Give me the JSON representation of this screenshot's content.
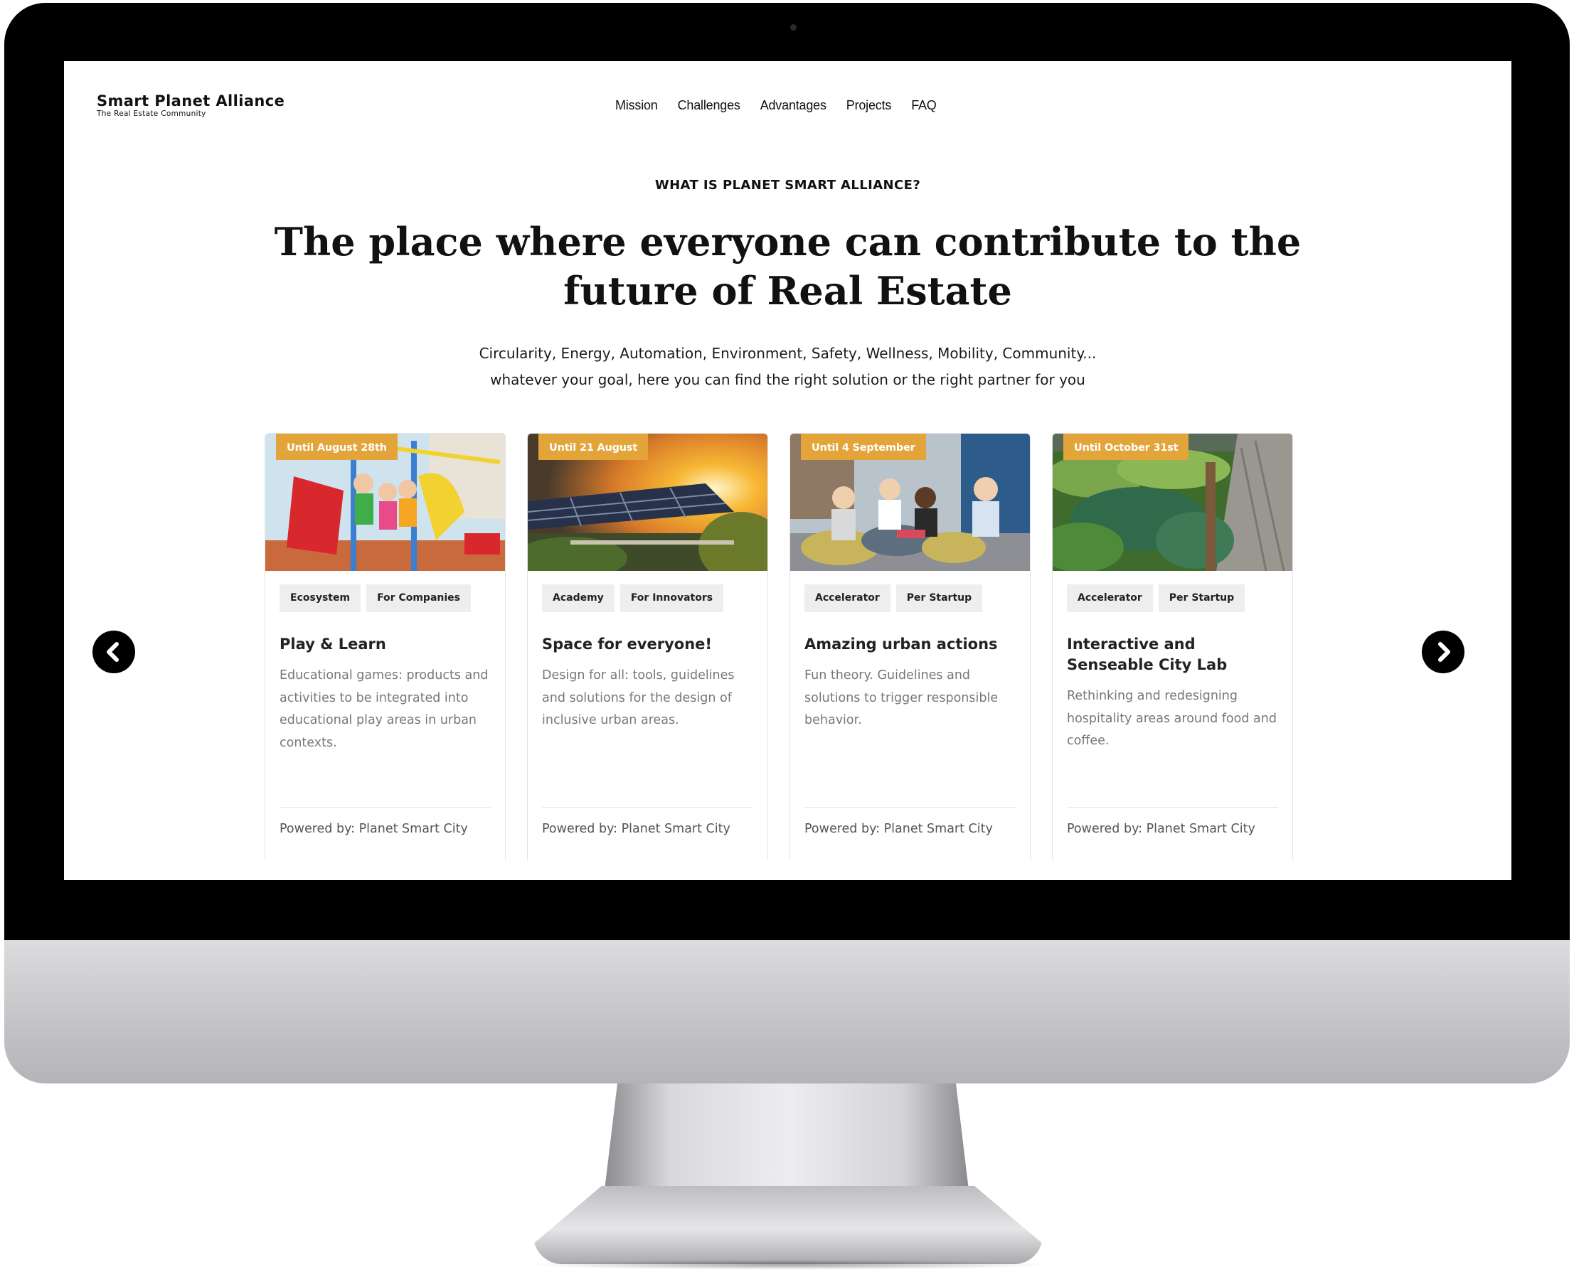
{
  "brand": {
    "name": "Smart Planet Alliance",
    "tagline": "The Real Estate Community"
  },
  "nav": [
    {
      "label": "Mission"
    },
    {
      "label": "Challenges"
    },
    {
      "label": "Advantages"
    },
    {
      "label": "Projects"
    },
    {
      "label": "FAQ"
    }
  ],
  "hero": {
    "eyebrow": "WHAT IS PLANET SMART ALLIANCE?",
    "headline_line1": "The place where everyone can contribute to the",
    "headline_line2": "future of Real Estate",
    "sub_line1": "Circularity, Energy, Automation, Environment, Safety, Wellness, Mobility, Community...",
    "sub_line2": "whatever your goal, here you can find the right solution or the right partner for you"
  },
  "cards": [
    {
      "badge": "Until August 28th",
      "tags": [
        "Ecosystem",
        "For Companies"
      ],
      "title": "Play & Learn",
      "text": "Educational games: products and activities to be integrated into educational play areas in urban contexts.",
      "footer": "Powered by: Planet Smart City"
    },
    {
      "badge": "Until 21 August",
      "tags": [
        "Academy",
        "For Innovators"
      ],
      "title": "Space for everyone!",
      "text": "Design for all: tools, guidelines and solutions for the design of inclusive urban areas.",
      "footer": "Powered by: Planet Smart City"
    },
    {
      "badge": "Until 4 September",
      "tags": [
        "Accelerator",
        "Per Startup"
      ],
      "title": "Amazing urban actions",
      "text": "Fun theory. Guidelines and solutions to trigger responsible behavior.",
      "footer": "Powered by: Planet Smart City"
    },
    {
      "badge": "Until October 31st",
      "tags": [
        "Accelerator",
        "Per Startup"
      ],
      "title": "Interactive and Senseable City Lab",
      "text": "Rethinking and redesigning hospitality areas around food and coffee.",
      "footer": "Powered by: Planet Smart City"
    }
  ],
  "colors": {
    "accent": "#e3a43a",
    "text": "#111111",
    "muted": "#777777",
    "tag_bg": "#eeeeee"
  },
  "icons": {
    "prev": "chevron-left-icon",
    "next": "chevron-right-icon"
  }
}
